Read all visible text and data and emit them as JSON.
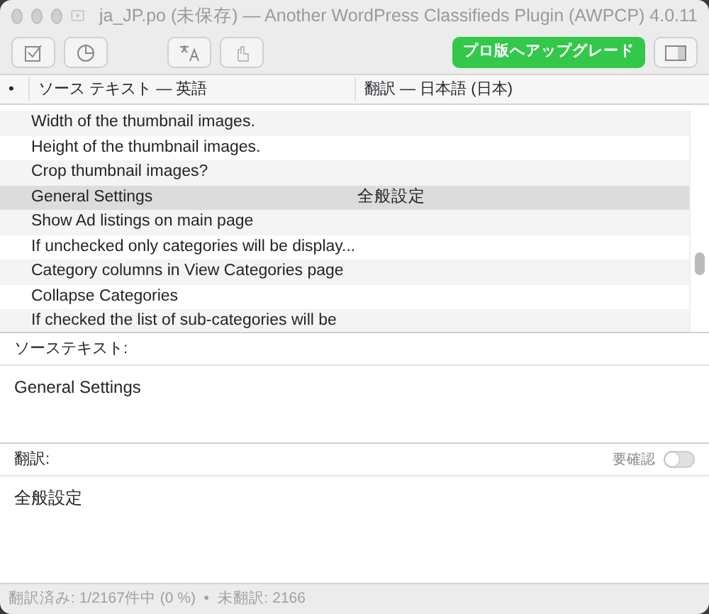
{
  "window": {
    "title": "ja_JP.po (未保存) — Another WordPress Classifieds Plugin (AWPCP) 4.0.11"
  },
  "toolbar": {
    "upgrade_button": "プロ版へアップグレード"
  },
  "table": {
    "columns": [
      "•",
      "ソース テキスト — 英語",
      "翻訳 — 日本語 (日本)"
    ],
    "rows": [
      {
        "source": "Width of the thumbnail images.",
        "translation": "",
        "selected": false
      },
      {
        "source": "Height of the thumbnail images.",
        "translation": "",
        "selected": false
      },
      {
        "source": "Crop thumbnail images?",
        "translation": "",
        "selected": false
      },
      {
        "source": "General Settings",
        "translation": "全般設定",
        "selected": true
      },
      {
        "source": "Show Ad listings on main page",
        "translation": "",
        "selected": false
      },
      {
        "source": "If unchecked only categories will be display...",
        "translation": "",
        "selected": false
      },
      {
        "source": "Category columns in View Categories page",
        "translation": "",
        "selected": false
      },
      {
        "source": "Collapse Categories",
        "translation": "",
        "selected": false
      },
      {
        "source": "If checked the list of sub-categories will be",
        "translation": "",
        "selected": false
      }
    ]
  },
  "source_panel": {
    "label": "ソーステキスト:",
    "text": "General Settings"
  },
  "translation_panel": {
    "label": "翻訳:",
    "needs_review_label": "要確認",
    "needs_review": false,
    "text": "全般設定"
  },
  "status_bar": "翻訳済み: 1/2167件中 (0 %)  •  未翻訳: 2166"
}
